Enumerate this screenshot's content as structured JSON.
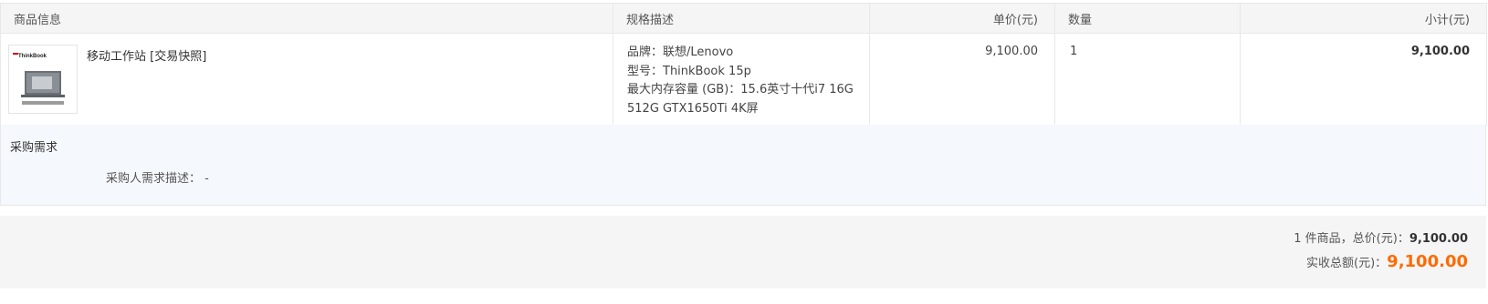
{
  "table": {
    "headers": {
      "product": "商品信息",
      "spec": "规格描述",
      "unit_price": "单价(元)",
      "quantity": "数量",
      "subtotal": "小计(元)"
    },
    "row": {
      "thumbnail_brand": "ThinkBook",
      "product_name": "移动工作站 [交易快照]",
      "spec_lines": [
        "品牌：联想/Lenovo",
        "型号：ThinkBook 15p",
        "最大内存容量 (GB)：15.6英寸十代i7 16G",
        "512G GTX1650Ti 4K屏"
      ],
      "unit_price": "9,100.00",
      "quantity": "1",
      "subtotal": "9,100.00"
    }
  },
  "requirements": {
    "title": "采购需求",
    "desc_label": "采购人需求描述：",
    "desc_value": "-"
  },
  "summary": {
    "count_prefix": "1 件商品，总价(元)：",
    "total_price": "9,100.00",
    "received_label": "实收总额(元)：",
    "received_amount": "9,100.00"
  },
  "colors": {
    "accent": "#ff6a00",
    "header_bg": "#f5f5f5",
    "req_bg": "#f5f8fc"
  }
}
